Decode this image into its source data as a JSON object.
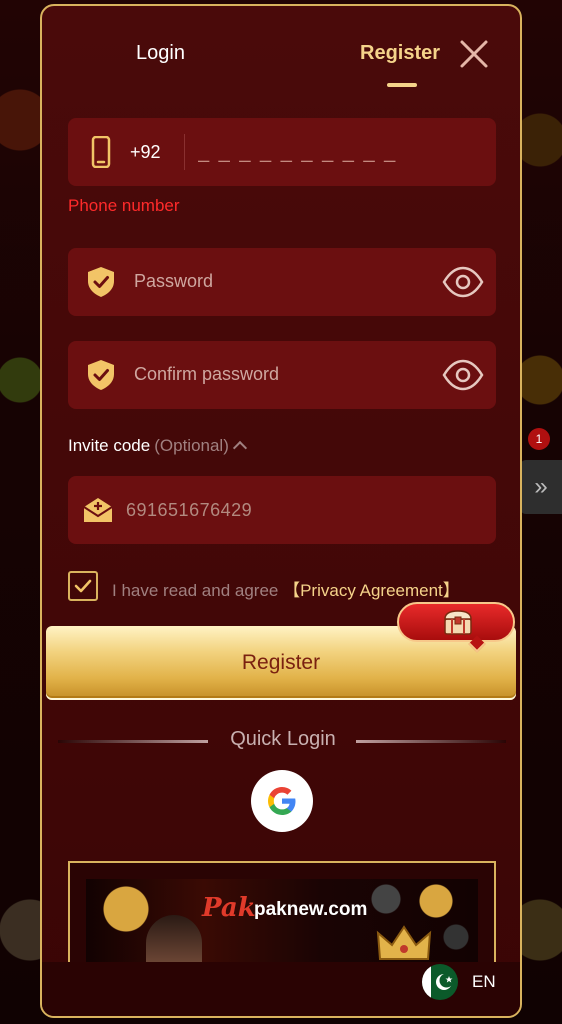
{
  "tabs": {
    "login_label": "Login",
    "register_label": "Register",
    "active": "Register"
  },
  "phone": {
    "country_code": "+92",
    "placeholder": "_ _ _ _ _ _ _ _ _ _",
    "error": "Phone number"
  },
  "password": {
    "placeholder": "Password"
  },
  "confirm_password": {
    "placeholder": "Confirm password"
  },
  "invite": {
    "label": "Invite code",
    "optional": "(Optional)",
    "value": "691651676429"
  },
  "agreement": {
    "text": "I have read and agree",
    "link": "【Privacy Agreement】",
    "checked": true
  },
  "register_button_label": "Register",
  "quick_login": {
    "title": "Quick Login",
    "provider_icon": "google-icon"
  },
  "banner": {
    "brand": "Pak",
    "domain": "paknew.com"
  },
  "language": {
    "code": "EN",
    "flag": "pakistan-flag-icon"
  },
  "colors": {
    "accent_gold": "#f5d38a",
    "panel": "#4a0a0a",
    "field": "#6b0f10",
    "error": "#ff2a2a"
  }
}
